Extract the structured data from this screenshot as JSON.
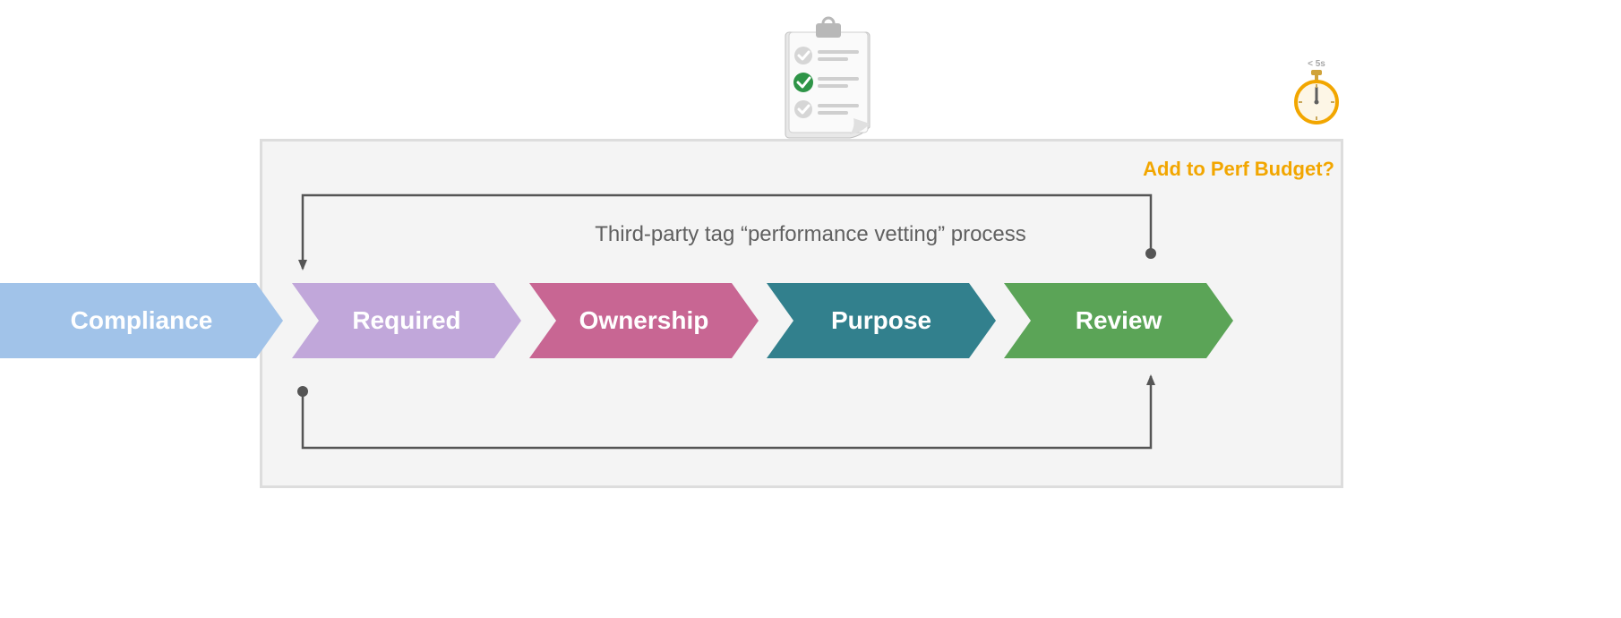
{
  "diagram": {
    "process_title": "Third-party tag “performance vetting” process",
    "perf_budget_label": "Add to Perf Budget?",
    "stopwatch_caption": "< 5s"
  },
  "steps": [
    {
      "label": "Compliance",
      "fill": "#a1c3e9",
      "text": "#ffffff"
    },
    {
      "label": "Required",
      "fill": "#c1a7da",
      "text": "#ffffff"
    },
    {
      "label": "Ownership",
      "fill": "#c86693",
      "text": "#ffffff"
    },
    {
      "label": "Purpose",
      "fill": "#32808d",
      "text": "#ffffff"
    },
    {
      "label": "Review",
      "fill": "#5ba457",
      "text": "#ffffff"
    }
  ],
  "chart_data": {
    "type": "process-flow",
    "title": "Third-party tag “performance vetting” process",
    "nodes": [
      "Compliance",
      "Required",
      "Ownership",
      "Purpose",
      "Review"
    ],
    "edges": [
      {
        "from": "Compliance",
        "to": "Required",
        "type": "sequence"
      },
      {
        "from": "Required",
        "to": "Ownership",
        "type": "sequence"
      },
      {
        "from": "Ownership",
        "to": "Purpose",
        "type": "sequence"
      },
      {
        "from": "Purpose",
        "to": "Review",
        "type": "sequence"
      },
      {
        "from": "Review",
        "to": "Required",
        "type": "feedback-loop-top"
      },
      {
        "from": "Required",
        "to": "Review",
        "type": "feedback-loop-bottom"
      }
    ],
    "annotations": [
      {
        "text": "Add to Perf Budget?",
        "icon": "stopwatch",
        "caption": "< 5s",
        "position": "top-right"
      },
      {
        "icon": "checklist-clipboard",
        "position": "top-center"
      }
    ],
    "process_scope": {
      "inside_box": [
        "Required",
        "Ownership",
        "Purpose",
        "Review"
      ],
      "outside_box": [
        "Compliance"
      ]
    }
  }
}
